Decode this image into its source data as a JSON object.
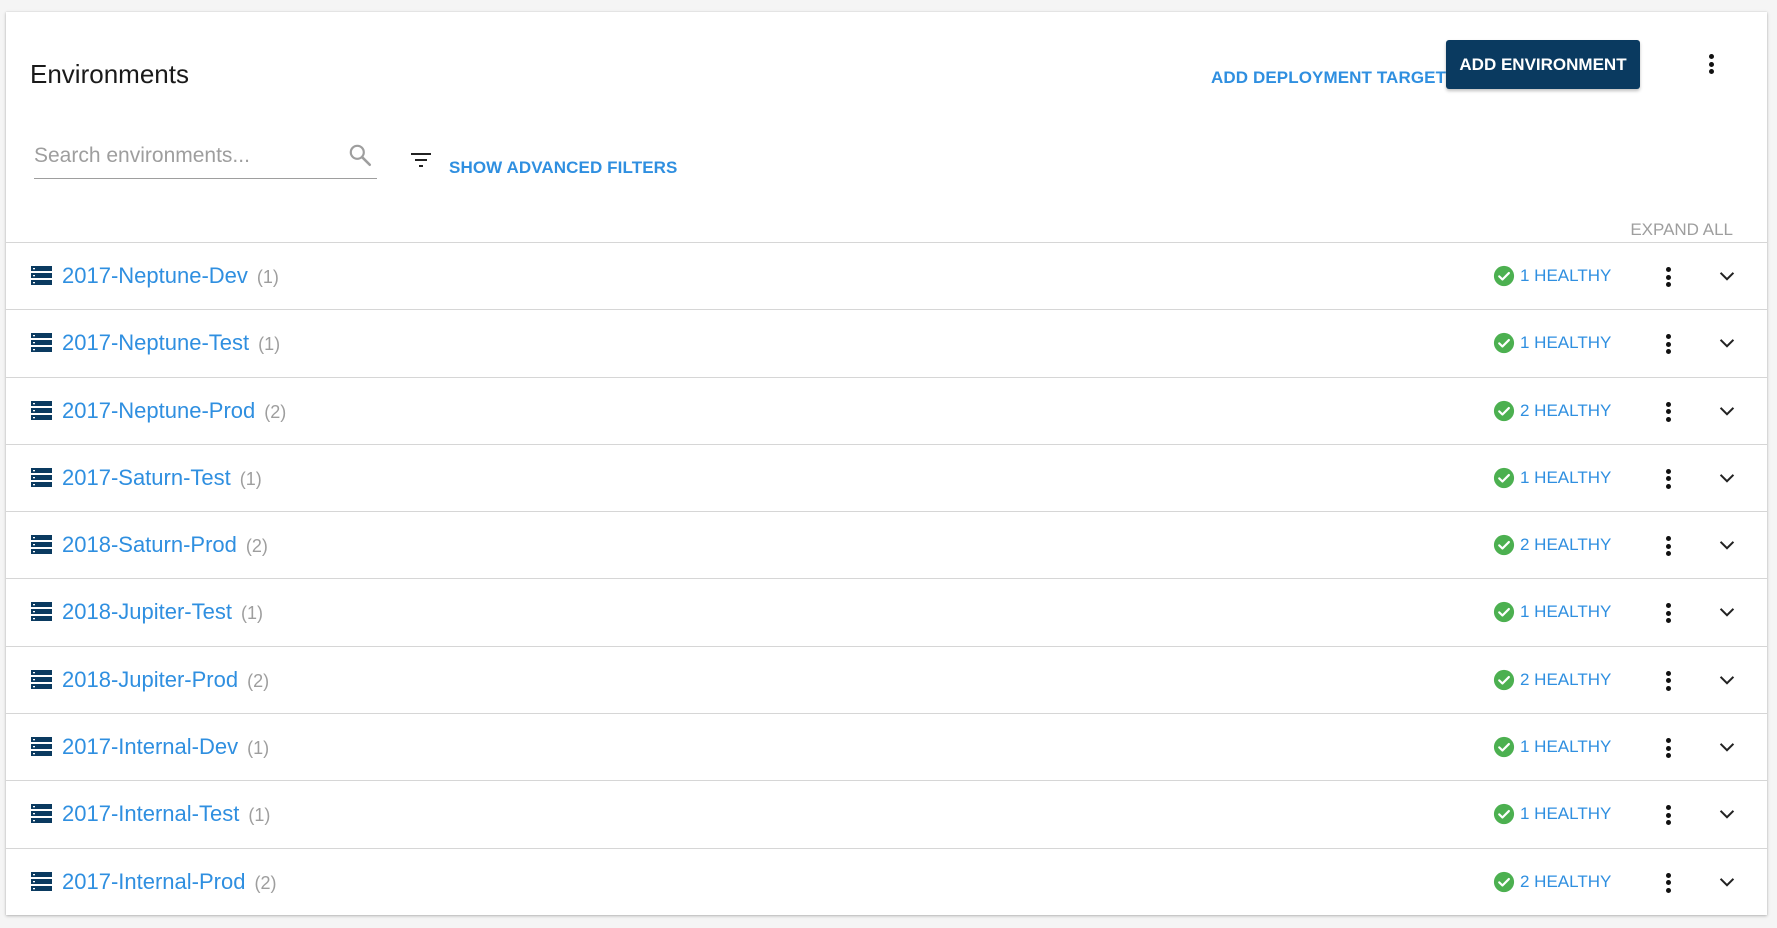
{
  "header": {
    "title": "Environments",
    "add_deployment_target_label": "ADD DEPLOYMENT TARGET",
    "add_environment_label": "ADD ENVIRONMENT",
    "more_icon": "kebab-vertical-icon"
  },
  "search": {
    "placeholder": "Search environments...",
    "value": "",
    "icon": "search-icon"
  },
  "filters": {
    "show_advanced_label": "SHOW ADVANCED FILTERS",
    "icon": "filter-list-icon"
  },
  "expand_all_label": "EXPAND ALL",
  "colors": {
    "link_blue": "#2f8fe0",
    "primary_navy": "#0a3a60",
    "healthy_green": "#4cb050",
    "muted_gray": "#9e9e9e"
  },
  "environments": [
    {
      "name": "2017-Neptune-Dev",
      "count": "(1)",
      "health": "1 HEALTHY"
    },
    {
      "name": "2017-Neptune-Test",
      "count": "(1)",
      "health": "1 HEALTHY"
    },
    {
      "name": "2017-Neptune-Prod",
      "count": "(2)",
      "health": "2 HEALTHY"
    },
    {
      "name": "2017-Saturn-Test",
      "count": "(1)",
      "health": "1 HEALTHY"
    },
    {
      "name": "2018-Saturn-Prod",
      "count": "(2)",
      "health": "2 HEALTHY"
    },
    {
      "name": "2018-Jupiter-Test",
      "count": "(1)",
      "health": "1 HEALTHY"
    },
    {
      "name": "2018-Jupiter-Prod",
      "count": "(2)",
      "health": "2 HEALTHY"
    },
    {
      "name": "2017-Internal-Dev",
      "count": "(1)",
      "health": "1 HEALTHY"
    },
    {
      "name": "2017-Internal-Test",
      "count": "(1)",
      "health": "1 HEALTHY"
    },
    {
      "name": "2017-Internal-Prod",
      "count": "(2)",
      "health": "2 HEALTHY"
    }
  ]
}
